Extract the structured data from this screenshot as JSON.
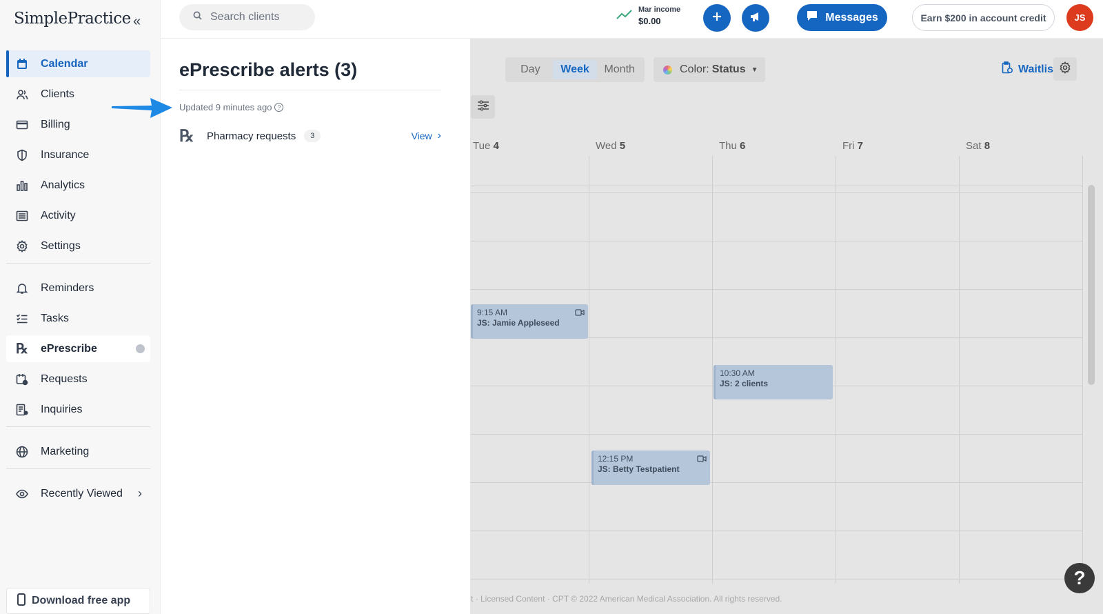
{
  "app": {
    "logo": "SimplePractice",
    "collapse_glyph": "«"
  },
  "search": {
    "placeholder": "Search clients"
  },
  "income": {
    "label": "Mar income",
    "value": "$0.00"
  },
  "topbar": {
    "messages_label": "Messages",
    "credit_label": "Earn $200 in account credit",
    "avatar_initials": "JS"
  },
  "sidebar": {
    "items": [
      {
        "label": "Calendar",
        "icon": "calendar-icon"
      },
      {
        "label": "Clients",
        "icon": "users-icon"
      },
      {
        "label": "Billing",
        "icon": "credit-card-icon"
      },
      {
        "label": "Insurance",
        "icon": "shield-icon"
      },
      {
        "label": "Analytics",
        "icon": "bar-chart-icon"
      },
      {
        "label": "Activity",
        "icon": "list-icon"
      },
      {
        "label": "Settings",
        "icon": "gear-icon"
      },
      {
        "label": "Reminders",
        "icon": "bell-icon"
      },
      {
        "label": "Tasks",
        "icon": "checklist-icon"
      },
      {
        "label": "ePrescribe",
        "icon": "rx-icon"
      },
      {
        "label": "Requests",
        "icon": "calendar-request-icon"
      },
      {
        "label": "Inquiries",
        "icon": "inquiry-icon"
      },
      {
        "label": "Marketing",
        "icon": "globe-icon"
      },
      {
        "label": "Recently Viewed",
        "icon": "eye-icon"
      }
    ],
    "download_label": "Download free app"
  },
  "alerts": {
    "title": "ePrescribe alerts (3)",
    "updated": "Updated 9 minutes ago",
    "row_label": "Pharmacy requests",
    "row_count": "3",
    "view_label": "View",
    "rx_glyph": "℞"
  },
  "calendar": {
    "views": [
      "Day",
      "Week",
      "Month"
    ],
    "active_view": "Week",
    "color_label": "Color:",
    "color_value": "Status",
    "waitlist_label": "Waitlist",
    "days": [
      {
        "name": "Tue",
        "num": "4"
      },
      {
        "name": "Wed",
        "num": "5"
      },
      {
        "name": "Thu",
        "num": "6"
      },
      {
        "name": "Fri",
        "num": "7"
      },
      {
        "name": "Sat",
        "num": "8"
      }
    ],
    "appointments": [
      {
        "time": "9:15 AM",
        "name": "JS: Jamie Appleseed",
        "video": true
      },
      {
        "time": "10:30 AM",
        "name": "JS: 2 clients",
        "video": false
      },
      {
        "time": "12:15 PM",
        "name": "JS: Betty Testpatient",
        "video": true
      }
    ],
    "footer": "t · Licensed Content · CPT © 2022 American Medical Association. All rights reserved.",
    "help_glyph": "?"
  },
  "colors": {
    "brand": "#1566c0",
    "avatar": "#dc3b1e",
    "annotation_arrow": "#1e88e5"
  }
}
